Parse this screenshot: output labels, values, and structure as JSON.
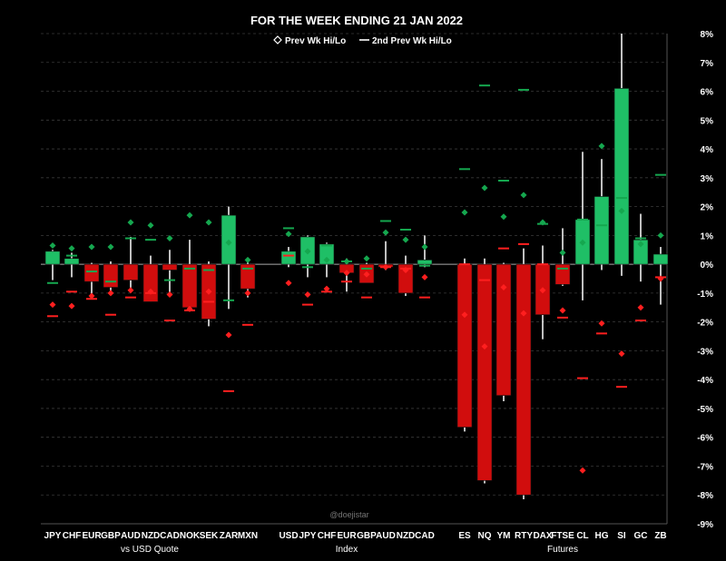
{
  "chart_data": {
    "type": "candlestick",
    "title": "FOR THE WEEK ENDING 21 JAN 2022",
    "legend": [
      {
        "label": "Prev Wk Hi/Lo",
        "marker": "diamond"
      },
      {
        "label": "2nd Prev Wk Hi/Lo",
        "marker": "dash"
      }
    ],
    "watermark": "@doejistar",
    "y_axis": {
      "min": -9,
      "max": 8,
      "ticks": [
        "8%",
        "7%",
        "6%",
        "5%",
        "4%",
        "3%",
        "2%",
        "1%",
        "0%",
        "-1%",
        "-2%",
        "-3%",
        "-4%",
        "-5%",
        "-6%",
        "-7%",
        "-8%",
        "-9%"
      ],
      "position": "right",
      "grid": true
    },
    "colors": {
      "up": "#1fbf66",
      "down": "#d10d0d",
      "prev_up": "#15a74f",
      "prev_down": "#ff1f1f",
      "grid": "#3a3a3a",
      "zero": "#aaaaaa"
    },
    "groups": [
      {
        "label": "vs USD Quote",
        "items": [
          {
            "name": "JPY",
            "open": 0,
            "close": 0.45,
            "high": 0.5,
            "low": -0.55,
            "prev_hi": 0.65,
            "prev_lo": -1.4,
            "prev2_hi": -0.65,
            "prev2_lo": -1.8
          },
          {
            "name": "CHF",
            "open": 0,
            "close": 0.2,
            "high": 0.4,
            "low": -0.45,
            "prev_hi": 0.55,
            "prev_lo": -1.45,
            "prev2_hi": 0.3,
            "prev2_lo": -0.95
          },
          {
            "name": "EUR",
            "open": 0,
            "close": -0.6,
            "high": 0.05,
            "low": -1.15,
            "prev_hi": 0.6,
            "prev_lo": -1.1,
            "prev2_hi": -0.25,
            "prev2_lo": -1.2
          },
          {
            "name": "GBP",
            "open": 0,
            "close": -0.8,
            "high": 0.1,
            "low": -1.0,
            "prev_hi": 0.6,
            "prev_lo": -1.0,
            "prev2_hi": -0.6,
            "prev2_lo": -1.75
          },
          {
            "name": "AUD",
            "open": 0,
            "close": -0.55,
            "high": 0.95,
            "low": -0.95,
            "prev_hi": 1.45,
            "prev_lo": -0.9,
            "prev2_hi": 0.9,
            "prev2_lo": -1.15
          },
          {
            "name": "NZD",
            "open": 0,
            "close": -1.3,
            "high": 0.3,
            "low": -1.3,
            "prev_hi": 1.35,
            "prev_lo": -0.95,
            "prev2_hi": 0.85,
            "prev2_lo": -1.0
          },
          {
            "name": "CAD",
            "open": 0,
            "close": -0.2,
            "high": 0.5,
            "low": -1.0,
            "prev_hi": 0.9,
            "prev_lo": -1.05,
            "prev2_hi": -0.55,
            "prev2_lo": -1.95
          },
          {
            "name": "NOK",
            "open": 0,
            "close": -1.5,
            "high": 0.85,
            "low": -1.55,
            "prev_hi": 1.7,
            "prev_lo": -1.55,
            "prev2_hi": -0.15,
            "prev2_lo": -1.6
          },
          {
            "name": "SEK",
            "open": 0,
            "close": -1.9,
            "high": 0.1,
            "low": -2.15,
            "prev_hi": 1.45,
            "prev_lo": -0.95,
            "prev2_hi": -0.2,
            "prev2_lo": -1.3
          },
          {
            "name": "ZAR",
            "open": 0,
            "close": 1.7,
            "high": 2.0,
            "low": -1.55,
            "prev_hi": 0.75,
            "prev_lo": -2.45,
            "prev2_hi": -1.25,
            "prev2_lo": -4.4
          },
          {
            "name": "MXN",
            "open": 0,
            "close": -0.85,
            "high": 0.1,
            "low": -1.15,
            "prev_hi": 0.15,
            "prev_lo": -1.0,
            "prev2_hi": -0.15,
            "prev2_lo": -2.1
          }
        ]
      },
      {
        "label": "Index",
        "items": [
          {
            "name": "USD",
            "open": 0,
            "close": 0.45,
            "high": 0.6,
            "low": -0.1,
            "prev_hi": 1.05,
            "prev_lo": -0.65,
            "prev2_hi": 1.25,
            "prev2_lo": 0.3
          },
          {
            "name": "JPY",
            "open": 0,
            "close": 0.95,
            "high": 1.0,
            "low": -0.45,
            "prev_hi": 0.45,
            "prev_lo": -1.05,
            "prev2_hi": -0.1,
            "prev2_lo": -1.4
          },
          {
            "name": "CHF",
            "open": 0,
            "close": 0.7,
            "high": 0.75,
            "low": -0.45,
            "prev_hi": 0.15,
            "prev_lo": -0.85,
            "prev2_hi": 0.65,
            "prev2_lo": -0.95
          },
          {
            "name": "EUR",
            "open": 0,
            "close": -0.3,
            "high": 0.2,
            "low": -0.95,
            "prev_hi": 0.1,
            "prev_lo": -0.3,
            "prev2_hi": 0.1,
            "prev2_lo": -0.6
          },
          {
            "name": "GBP",
            "open": 0,
            "close": -0.65,
            "high": 0.05,
            "low": -0.65,
            "prev_hi": 0.2,
            "prev_lo": -0.35,
            "prev2_hi": -0.15,
            "prev2_lo": -1.15
          },
          {
            "name": "AUD",
            "open": 0,
            "close": -0.1,
            "high": 0.8,
            "low": -0.2,
            "prev_hi": 1.1,
            "prev_lo": -0.1,
            "prev2_hi": 1.5,
            "prev2_lo": -0.1
          },
          {
            "name": "NZD",
            "open": 0,
            "close": -1.0,
            "high": 0.3,
            "low": -1.1,
            "prev_hi": 0.85,
            "prev_lo": -0.2,
            "prev2_hi": 1.2,
            "prev2_lo": -0.15
          },
          {
            "name": "CAD",
            "open": 0,
            "close": 0.15,
            "high": 1.0,
            "low": -0.1,
            "prev_hi": 0.6,
            "prev_lo": -0.45,
            "prev2_hi": -0.05,
            "prev2_lo": -1.15
          }
        ]
      },
      {
        "label": "Futures",
        "items": [
          {
            "name": "ES",
            "open": 0,
            "close": -5.65,
            "high": 0.2,
            "low": -5.8,
            "prev_hi": 1.8,
            "prev_lo": -1.75,
            "prev2_hi": 3.3,
            "prev2_lo": 0.0
          },
          {
            "name": "NQ",
            "open": 0,
            "close": -7.5,
            "high": 0.2,
            "low": -7.6,
            "prev_hi": 2.65,
            "prev_lo": -2.85,
            "prev2_hi": 6.2,
            "prev2_lo": -0.55
          },
          {
            "name": "YM",
            "open": 0,
            "close": -4.55,
            "high": 0.05,
            "low": -4.75,
            "prev_hi": 1.65,
            "prev_lo": -0.8,
            "prev2_hi": 2.9,
            "prev2_lo": 0.55
          },
          {
            "name": "RTY",
            "open": 0,
            "close": -8.0,
            "high": 0.55,
            "low": -8.15,
            "prev_hi": 2.4,
            "prev_lo": -1.7,
            "prev2_hi": 6.05,
            "prev2_lo": 0.7
          },
          {
            "name": "DAX",
            "open": 0,
            "close": -1.75,
            "high": 0.65,
            "low": -2.6,
            "prev_hi": 1.45,
            "prev_lo": -0.9,
            "prev2_hi": 1.4,
            "prev2_lo": 0.0
          },
          {
            "name": "FTSE",
            "open": 0,
            "close": -0.7,
            "high": 1.25,
            "low": -0.75,
            "prev_hi": 0.4,
            "prev_lo": -1.6,
            "prev2_hi": -0.15,
            "prev2_lo": -1.85
          },
          {
            "name": "CL",
            "open": 0,
            "close": 1.55,
            "high": 3.9,
            "low": -1.25,
            "prev_hi": 0.75,
            "prev_lo": -7.15,
            "prev2_hi": 1.55,
            "prev2_lo": -3.95
          },
          {
            "name": "HG",
            "open": 0,
            "close": 2.35,
            "high": 3.65,
            "low": -0.2,
            "prev_hi": 4.1,
            "prev_lo": -2.05,
            "prev2_hi": 1.35,
            "prev2_lo": -2.4
          },
          {
            "name": "SI",
            "open": 0,
            "close": 6.1,
            "high": 8.0,
            "low": -0.4,
            "prev_hi": 1.85,
            "prev_lo": -3.1,
            "prev2_hi": 2.3,
            "prev2_lo": -4.25
          },
          {
            "name": "GC",
            "open": 0,
            "close": 0.85,
            "high": 1.75,
            "low": -0.6,
            "prev_hi": 0.7,
            "prev_lo": -1.5,
            "prev2_hi": 0.9,
            "prev2_lo": -1.95
          },
          {
            "name": "ZB",
            "open": 0,
            "close": 0.35,
            "high": 0.6,
            "low": -1.4,
            "prev_hi": 1.0,
            "prev_lo": -0.5,
            "prev2_hi": 3.1,
            "prev2_lo": -0.45
          }
        ]
      }
    ]
  }
}
